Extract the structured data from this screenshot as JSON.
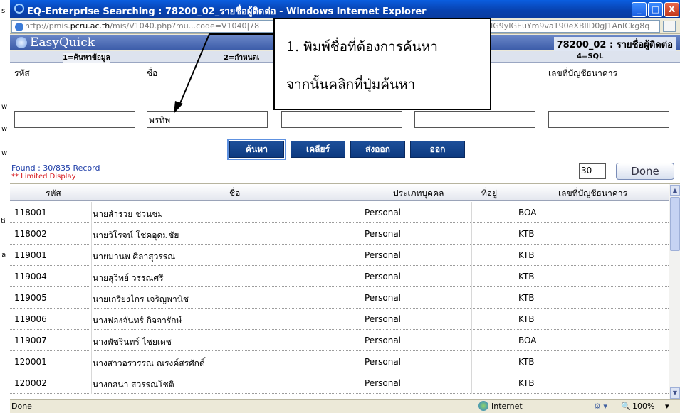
{
  "window": {
    "title": "EQ-Enterprise Searching : 78200_02_รายชื่อผู้ติดต่อ - Windows Internet Explorer",
    "minimize": "_",
    "maximize": "□",
    "close": "X"
  },
  "address": {
    "url_part1": "http://pmis.",
    "url_part2": "pcru.ac.th",
    "url_part3": "/mis/V1040.php?mu",
    "url_part4": "...code=V1040|78",
    "url_tail": "IG9yIGEuYm9va190eXBlID0gJ1AnICkg8q"
  },
  "header": {
    "brand": "EasyQuick",
    "page_code": "78200_02 : รายชื่อผู้ติดต่อ"
  },
  "tabs": [
    {
      "label": "1=ค้นหาข้อมูล"
    },
    {
      "label": "2=กำหนดเ"
    },
    {
      "label": "4=SQL"
    }
  ],
  "form": {
    "code_label": "รหัส",
    "name_label": "ชื่อ",
    "bank_label": "เลขที่บัญชีธนาคาร",
    "name_value": "พรทิพ"
  },
  "buttons": {
    "search": "ค้นหา",
    "clear": "เคลียร์",
    "export": "ส่งออก",
    "exit": "ออก",
    "done": "Done"
  },
  "found": {
    "text": "Found : 30/835 Record",
    "limited": "** Limited Display",
    "page_size": "30"
  },
  "table": {
    "headers": [
      "รหัส",
      "ชื่อ",
      "ประเภทบุคคล",
      "ที่อยู่",
      "เลขที่บัญชีธนาคาร"
    ],
    "rows": [
      {
        "code": "118001",
        "name": "นายสำรวย ชวนชม",
        "type": "Personal",
        "address": "",
        "bank": "BOA"
      },
      {
        "code": "118002",
        "name": "นายวิโรจน์ โชคอุดมชัย",
        "type": "Personal",
        "address": "",
        "bank": "KTB"
      },
      {
        "code": "119001",
        "name": "นายมานพ ศิลาสุวรรณ",
        "type": "Personal",
        "address": "",
        "bank": "KTB"
      },
      {
        "code": "119004",
        "name": "นายสุวิทย์ วรรณศรี",
        "type": "Personal",
        "address": "",
        "bank": "KTB"
      },
      {
        "code": "119005",
        "name": "นายเกรียงไกร เจริญพานิช",
        "type": "Personal",
        "address": "",
        "bank": "KTB"
      },
      {
        "code": "119006",
        "name": "นางฟองจันทร์ กิจจารักษ์",
        "type": "Personal",
        "address": "",
        "bank": "KTB"
      },
      {
        "code": "119007",
        "name": "นางพัชรินทร์ ไชยเดช",
        "type": "Personal",
        "address": "",
        "bank": "BOA"
      },
      {
        "code": "120001",
        "name": "นางสาวอรวรรณ ณรงค์สรศักดิ์",
        "type": "Personal",
        "address": "",
        "bank": "KTB"
      },
      {
        "code": "120002",
        "name": "นางกสนา สวรรณโชติ",
        "type": "Personal",
        "address": "",
        "bank": "KTB"
      }
    ]
  },
  "status": {
    "left": "Done",
    "zone": "Internet",
    "zoom": "100%"
  },
  "callout": {
    "line1": "1. พิมพ์ชื่อที่ต้องการค้นหา",
    "line2": "จากนั้นคลิกที่ปุ่มค้นหา"
  },
  "desktop_fragments": [
    "s",
    "w",
    "w",
    "w",
    "ti",
    "ล"
  ]
}
